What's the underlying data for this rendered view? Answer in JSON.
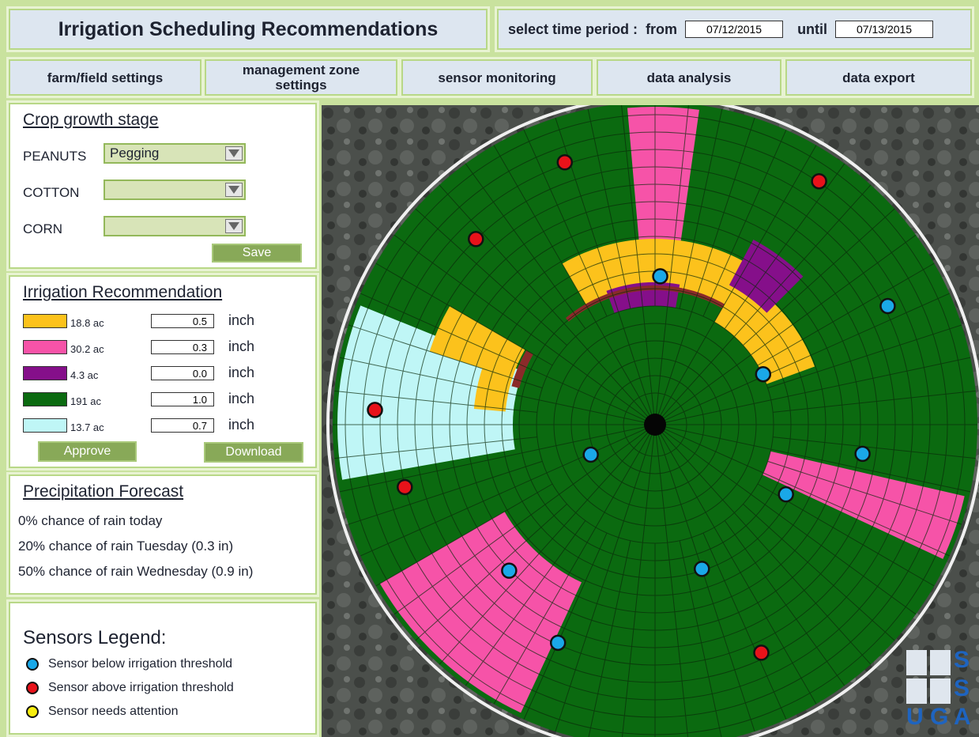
{
  "header": {
    "title": "Irrigation Scheduling Recommendations",
    "period_label": "select time period :",
    "from_label": "from",
    "from_value": "07/12/2015",
    "until_label": "until",
    "until_value": "07/13/2015"
  },
  "nav": [
    {
      "label": "farm/field settings"
    },
    {
      "label": "management zone settings"
    },
    {
      "label": "sensor monitoring"
    },
    {
      "label": "data analysis"
    },
    {
      "label": "data export"
    }
  ],
  "crop": {
    "heading": "Crop growth stage",
    "rows": [
      {
        "name": "PEANUTS",
        "value": "Pegging"
      },
      {
        "name": "COTTON",
        "value": ""
      },
      {
        "name": "CORN",
        "value": ""
      }
    ],
    "save_label": "Save"
  },
  "recommendation": {
    "heading": "Irrigation Recommendation",
    "rows": [
      {
        "color": "#fcc21c",
        "acres": "18.8 ac",
        "amount": "0.5",
        "unit": "inch"
      },
      {
        "color": "#f653a8",
        "acres": "30.2 ac",
        "amount": "0.3",
        "unit": "inch"
      },
      {
        "color": "#850f8a",
        "acres": "4.3 ac",
        "amount": "0.0",
        "unit": "inch"
      },
      {
        "color": "#0b6a10",
        "acres": "191 ac",
        "amount": "1.0",
        "unit": "inch"
      },
      {
        "color": "#bff6f6",
        "acres": "13.7 ac",
        "amount": "0.7",
        "unit": "inch"
      }
    ],
    "approve_label": "Approve",
    "download_label": "Download"
  },
  "forecast": {
    "heading": "Precipitation Forecast",
    "lines": [
      "0% chance of rain today",
      "20% chance of rain Tuesday (0.3 in)",
      "50% chance of rain Wednesday (0.9 in)"
    ]
  },
  "legend": {
    "heading": "Sensors Legend:",
    "items": [
      {
        "color": "#1aa8e8",
        "label": "Sensor below irrigation threshold"
      },
      {
        "color": "#e8121a",
        "label": "Sensor above irrigation threshold"
      },
      {
        "color": "#f8ee10",
        "label": "Sensor needs attention"
      }
    ]
  },
  "map": {
    "sensors": [
      {
        "status": "above",
        "angle_deg": -109,
        "r": 0.86
      },
      {
        "status": "above",
        "angle_deg": -56,
        "r": 0.91
      },
      {
        "status": "above",
        "angle_deg": -134,
        "r": 0.8
      },
      {
        "status": "below",
        "angle_deg": -88,
        "r": 0.46
      },
      {
        "status": "below",
        "angle_deg": -27,
        "r": 0.81
      },
      {
        "status": "below",
        "angle_deg": -25,
        "r": 0.37
      },
      {
        "status": "above",
        "angle_deg": -177,
        "r": 0.87
      },
      {
        "status": "below",
        "angle_deg": 8,
        "r": 0.65
      },
      {
        "status": "above",
        "angle_deg": 166,
        "r": 0.8
      },
      {
        "status": "below",
        "angle_deg": 28,
        "r": 0.46
      },
      {
        "status": "below",
        "angle_deg": 155,
        "r": 0.22
      },
      {
        "status": "below",
        "angle_deg": 72,
        "r": 0.47
      },
      {
        "status": "below",
        "angle_deg": 135,
        "r": 0.64
      },
      {
        "status": "below",
        "angle_deg": 114,
        "r": 0.74
      },
      {
        "status": "above",
        "angle_deg": 65,
        "r": 0.78
      }
    ],
    "logo": {
      "letters": [
        "S",
        "S",
        "U",
        "G",
        "A"
      ]
    }
  }
}
